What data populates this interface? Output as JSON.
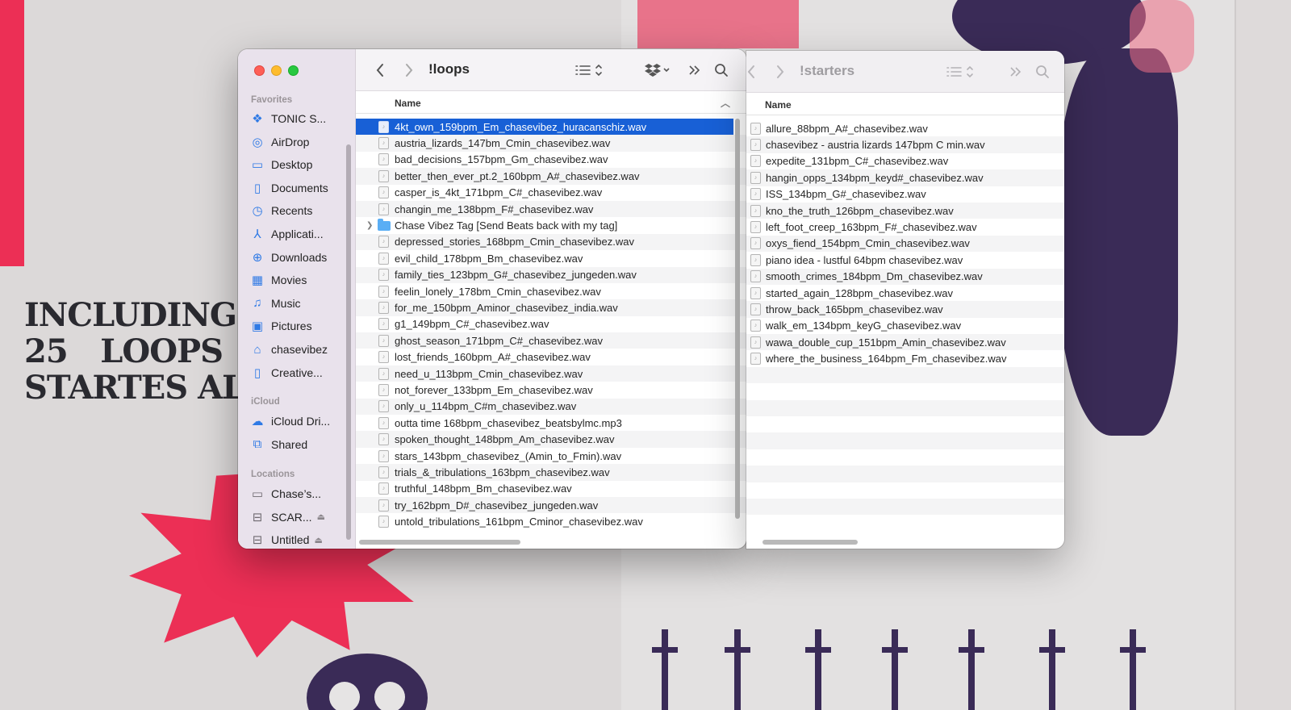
{
  "wallpaper": {
    "heading_lines": [
      "INCLUDING",
      [
        "25",
        "LOOPS"
      ],
      "STARTES ALL"
    ]
  },
  "finder_main": {
    "title": "!loops",
    "column_name": "Name",
    "sidebar": {
      "favorites_label": "Favorites",
      "favorites": [
        {
          "label": "TONIC S...",
          "icon": "dropbox-icon"
        },
        {
          "label": "AirDrop",
          "icon": "airdrop-icon"
        },
        {
          "label": "Desktop",
          "icon": "desktop-icon"
        },
        {
          "label": "Documents",
          "icon": "document-icon"
        },
        {
          "label": "Recents",
          "icon": "clock-icon"
        },
        {
          "label": "Applicati...",
          "icon": "applications-icon"
        },
        {
          "label": "Downloads",
          "icon": "download-icon"
        },
        {
          "label": "Movies",
          "icon": "film-icon"
        },
        {
          "label": "Music",
          "icon": "music-note-icon"
        },
        {
          "label": "Pictures",
          "icon": "photo-icon"
        },
        {
          "label": "chasevibez",
          "icon": "home-icon"
        },
        {
          "label": "Creative...",
          "icon": "document-icon"
        }
      ],
      "icloud_label": "iCloud",
      "icloud": [
        {
          "label": "iCloud Dri...",
          "icon": "cloud-icon"
        },
        {
          "label": "Shared",
          "icon": "shared-folder-icon"
        }
      ],
      "locations_label": "Locations",
      "locations": [
        {
          "label": "Chase’s...",
          "icon": "laptop-icon",
          "eject": false
        },
        {
          "label": "SCAR...",
          "icon": "drive-icon",
          "eject": true
        },
        {
          "label": "Untitled",
          "icon": "drive-icon",
          "eject": true
        }
      ]
    },
    "files": [
      {
        "name": "4kt_own_159bpm_Em_chasevibez_huracanschiz.wav",
        "type": "file",
        "selected": true
      },
      {
        "name": "austria_lizards_147bm_Cmin_chasevibez.wav",
        "type": "file"
      },
      {
        "name": "bad_decisions_157bpm_Gm_chasevibez.wav",
        "type": "file"
      },
      {
        "name": "better_then_ever_pt.2_160bpm_A#_chasevibez.wav",
        "type": "file"
      },
      {
        "name": "casper_is_4kt_171bpm_C#_chasevibez.wav",
        "type": "file"
      },
      {
        "name": "changin_me_138bpm_F#_chasevibez.wav",
        "type": "file"
      },
      {
        "name": "Chase Vibez Tag [Send Beats back with my tag]",
        "type": "folder"
      },
      {
        "name": "depressed_stories_168bpm_Cmin_chasevibez.wav",
        "type": "file"
      },
      {
        "name": "evil_child_178bpm_Bm_chasevibez.wav",
        "type": "file"
      },
      {
        "name": "family_ties_123bpm_G#_chasevibez_jungeden.wav",
        "type": "file"
      },
      {
        "name": "feelin_lonely_178bm_Cmin_chasevibez.wav",
        "type": "file"
      },
      {
        "name": "for_me_150bpm_Aminor_chasevibez_india.wav",
        "type": "file"
      },
      {
        "name": "g1_149bpm_C#_chasevibez.wav",
        "type": "file"
      },
      {
        "name": "ghost_season_171bpm_C#_chasevibez.wav",
        "type": "file"
      },
      {
        "name": "lost_friends_160bpm_A#_chasevibez.wav",
        "type": "file"
      },
      {
        "name": "need_u_113bpm_Cmin_chasevibez.wav",
        "type": "file"
      },
      {
        "name": "not_forever_133bpm_Em_chasevibez.wav",
        "type": "file"
      },
      {
        "name": "only_u_114bpm_C#m_chasevibez.wav",
        "type": "file"
      },
      {
        "name": "outta time 168bpm_chasevibez_beatsbylmc.mp3",
        "type": "file"
      },
      {
        "name": "spoken_thought_148bpm_Am_chasevibez.wav",
        "type": "file"
      },
      {
        "name": "stars_143bpm_chasevibez_(Amin_to_Fmin).wav",
        "type": "file"
      },
      {
        "name": "trials_&_tribulations_163bpm_chasevibez.wav",
        "type": "file"
      },
      {
        "name": "truthful_148bpm_Bm_chasevibez.wav",
        "type": "file"
      },
      {
        "name": "try_162bpm_D#_chasevibez_jungeden.wav",
        "type": "file"
      },
      {
        "name": "untold_tribulations_161bpm_Cminor_chasevibez.wav",
        "type": "file"
      }
    ]
  },
  "finder_second": {
    "title": "!starters",
    "column_name": "Name",
    "files": [
      "allure_88bpm_A#_chasevibez.wav",
      "chasevibez - austria lizards 147bpm C min.wav",
      "expedite_131bpm_C#_chasevibez.wav",
      "hangin_opps_134bpm_keyd#_chasevibez.wav",
      "ISS_134bpm_G#_chasevibez.wav",
      "kno_the_truth_126bpm_chasevibez.wav",
      "left_foot_creep_163bpm_F#_chasevibez.wav",
      "oxys_fiend_154bpm_Cmin_chasevibez.wav",
      "piano idea - lustful 64bpm chasevibez.wav",
      "smooth_crimes_184bpm_Dm_chasevibez.wav",
      "started_again_128bpm_chasevibez.wav",
      "throw_back_165bpm_chasevibez.wav",
      "walk_em_134bpm_keyG_chasevibez.wav",
      "wawa_double_cup_151bpm_Amin_chasevibez.wav",
      "where_the_business_164bpm_Fm_chasevibez.wav"
    ],
    "empty_rows": 10
  },
  "colors": {
    "selection": "#1860d6",
    "sidebar_icon": "#2f7ae5",
    "wallpaper_red": "#ec2f55",
    "wallpaper_purple": "#3a2b57"
  }
}
